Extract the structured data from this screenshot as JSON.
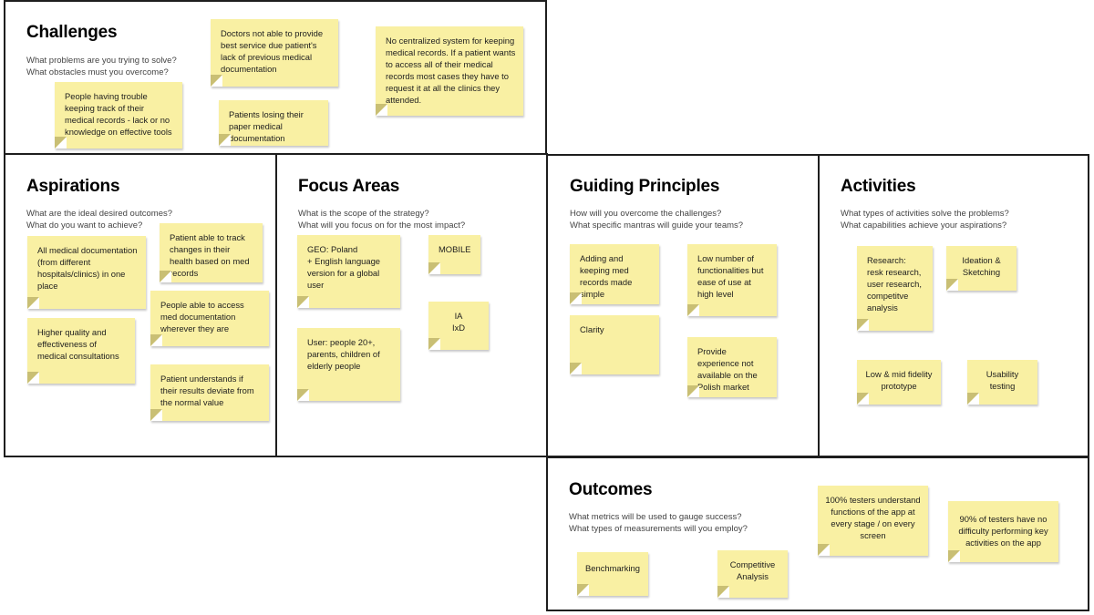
{
  "sections": {
    "challenges": {
      "title": "Challenges",
      "subtitle": [
        "What problems are you trying to solve?",
        "What obstacles must you overcome?"
      ],
      "notes": [
        "Doctors not able to provide best service due patient's lack of previous medical documentation",
        "No centralized system for keeping medical records. If a patient wants to access all of their medical records most cases they have to request it at all the clinics they attended.",
        "People having trouble keeping track of their medical records - lack or no knowledge on effective tools",
        "Patients losing their paper medical documentation"
      ]
    },
    "aspirations": {
      "title": "Aspirations",
      "subtitle": [
        "What are the ideal desired outcomes?",
        "What do you want to achieve?"
      ],
      "notes": [
        "All medical documentation (from different hospitals/clinics) in one place",
        "Patient able to track changes in their health based on med records",
        "People able to access med documentation wherever they are",
        "Higher quality and effectiveness of medical consultations",
        "Patient understands if their results deviate from the normal value"
      ]
    },
    "focus_areas": {
      "title": "Focus Areas",
      "subtitle": [
        "What is the scope of the strategy?",
        "What will you focus on for the most impact?"
      ],
      "notes": [
        "GEO: Poland\n+ English language version for a global user",
        "MOBILE",
        "IA\nIxD",
        "User: people 20+, parents, children of elderly people"
      ]
    },
    "guiding_principles": {
      "title": "Guiding Principles",
      "subtitle": [
        "How will you overcome the challenges?",
        "What specific mantras will guide your teams?"
      ],
      "notes": [
        "Adding and keeping med records made simple",
        "Low number of functionalities but ease of use at high level",
        "Clarity",
        "Provide experience not available on the Polish market"
      ]
    },
    "activities": {
      "title": "Activities",
      "subtitle": [
        "What types of activities solve the problems?",
        "What capabilities achieve your aspirations?"
      ],
      "notes": [
        "Research:\nresk research, user research, competitve analysis",
        "Ideation & Sketching",
        "Low & mid fidelity prototype",
        "Usability testing"
      ]
    },
    "outcomes": {
      "title": "Outcomes",
      "subtitle": [
        "What metrics will be used to gauge success?",
        "What types of measurements will you employ?"
      ],
      "notes": [
        "100% testers understand functions of the app at every stage / on every screen",
        "90% of testers have no difficulty performing key activities on the app",
        "Benchmarking",
        "Competitive Analysis"
      ]
    }
  },
  "colors": {
    "sticky": "#f9f0a3",
    "sticky_fold": "#c9bf74",
    "frame_border": "#1e1e1e"
  }
}
